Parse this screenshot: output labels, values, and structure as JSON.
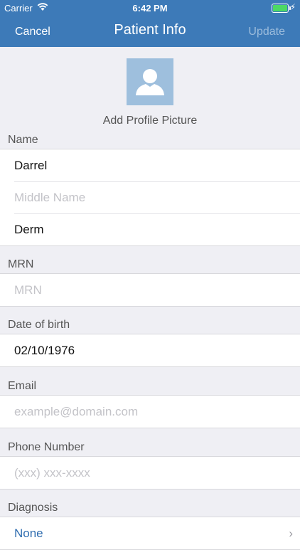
{
  "status_bar": {
    "carrier": "Carrier",
    "time": "6:42 PM",
    "battery_color": "#4cd964",
    "wifi_icon": "wifi-icon",
    "charging_icon": "bolt-icon"
  },
  "nav": {
    "cancel_label": "Cancel",
    "title": "Patient Info",
    "update_label": "Update",
    "bar_color": "#3d7ab8"
  },
  "profile": {
    "add_photo_label": "Add Profile Picture",
    "avatar_icon": "person-silhouette-icon"
  },
  "name_section": {
    "label": "Name",
    "first_value": "Darrel",
    "middle_placeholder": "Middle Name",
    "last_value": "Derm"
  },
  "mrn_section": {
    "label": "MRN",
    "placeholder": "MRN"
  },
  "dob_section": {
    "label": "Date of birth",
    "value": "02/10/1976"
  },
  "email_section": {
    "label": "Email",
    "placeholder": "example@domain.com"
  },
  "phone_section": {
    "label": "Phone Number",
    "placeholder": "(xxx) xxx-xxxx"
  },
  "diagnosis_section": {
    "label": "Diagnosis",
    "value": "None"
  }
}
